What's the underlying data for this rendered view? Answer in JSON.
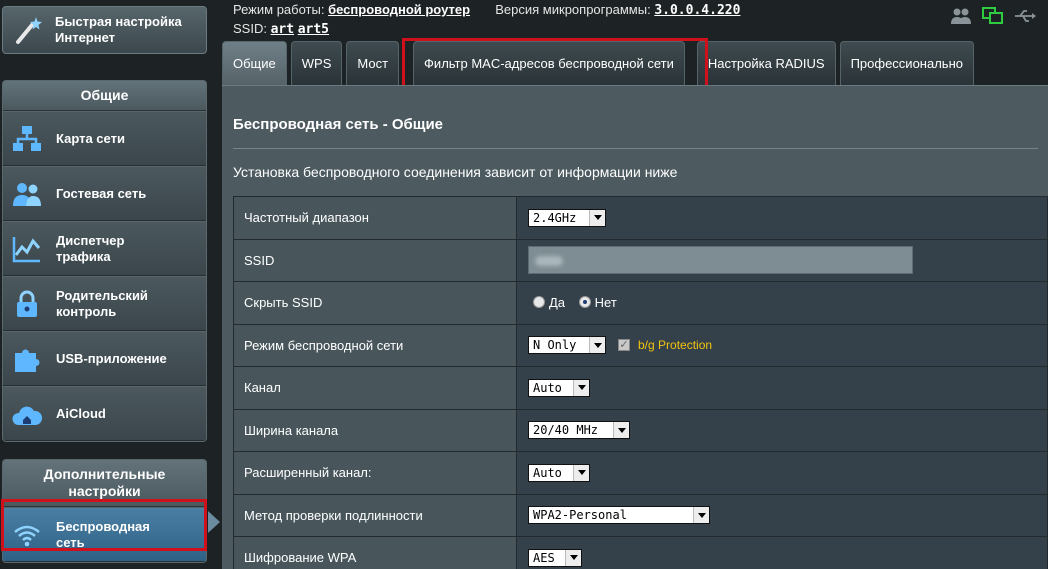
{
  "sidebar": {
    "quick_setup": {
      "label": "Быстрая настройка\nИнтернет"
    },
    "general": {
      "title": "Общие",
      "items": [
        {
          "id": "network-map",
          "label": "Карта сети"
        },
        {
          "id": "guest-network",
          "label": "Гостевая сеть"
        },
        {
          "id": "traffic-manager",
          "label": "Диспетчер\nтрафика"
        },
        {
          "id": "parental-control",
          "label": "Родительский\nконтроль"
        },
        {
          "id": "usb-app",
          "label": "USB-приложение"
        },
        {
          "id": "aicloud",
          "label": "AiCloud"
        }
      ]
    },
    "advanced": {
      "title": "Дополнительные\nнастройки",
      "items": [
        {
          "id": "wireless",
          "label": "Беспроводная\nсеть",
          "active": true
        }
      ]
    }
  },
  "topbar": {
    "mode_label": "Режим работы:",
    "mode_value": "беспроводной роутер",
    "firmware_label": "Версия микропрограммы:",
    "firmware_value": "3.0.0.4.220",
    "ssid_label": "SSID:",
    "ssid_values": [
      "art",
      "art5"
    ]
  },
  "tabs": [
    {
      "label": "Общие",
      "active": true
    },
    {
      "label": "WPS",
      "active": false
    },
    {
      "label": "Мост",
      "active": false
    },
    {
      "label": "Фильтр MAC-адресов беспроводной сети",
      "active": false
    },
    {
      "label": "Настройка RADIUS",
      "active": false
    },
    {
      "label": "Профессионально",
      "active": false
    }
  ],
  "panel": {
    "title": "Беспроводная сеть - Общие",
    "description": "Установка беспроводного соединения зависит от информации ниже",
    "fields": {
      "band": {
        "label": "Частотный диапазон",
        "value": "2.4GHz"
      },
      "ssid": {
        "label": "SSID"
      },
      "hide_ssid": {
        "label": "Скрыть SSID",
        "options": [
          "Да",
          "Нет"
        ],
        "selected": "Нет"
      },
      "mode": {
        "label": "Режим беспроводной сети",
        "value": "N Only",
        "protection_label": "b/g Protection",
        "protection_checked": true
      },
      "channel": {
        "label": "Канал",
        "value": "Auto"
      },
      "bandwidth": {
        "label": "Ширина канала",
        "value": "20/40 MHz"
      },
      "ext_channel": {
        "label": "Расширенный канал:",
        "value": "Auto"
      },
      "auth": {
        "label": "Метод проверки подлинности",
        "value": "WPA2-Personal"
      },
      "encryption": {
        "label": "Шифрование WPA",
        "value": "AES"
      }
    }
  },
  "colors": {
    "highlight": "#d0111c",
    "active_nav": "#2f6186",
    "protection_text": "#f1c40f"
  }
}
